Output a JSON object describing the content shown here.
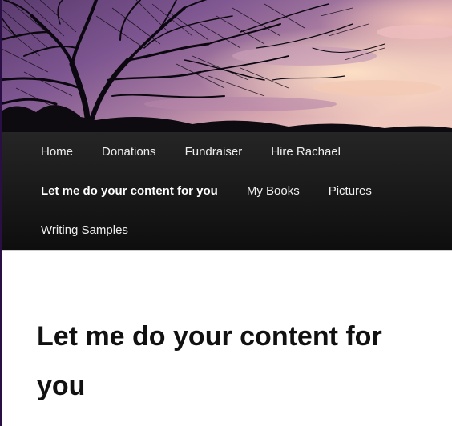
{
  "nav": {
    "items": [
      {
        "label": "Home"
      },
      {
        "label": "Donations"
      },
      {
        "label": "Fundraiser"
      },
      {
        "label": "Hire Rachael"
      },
      {
        "label": "Let me do your content for you"
      },
      {
        "label": "My Books"
      },
      {
        "label": "Pictures"
      },
      {
        "label": "Writing Samples"
      }
    ],
    "current_item": "Let me do your content for you"
  },
  "page": {
    "title": "Let me do your content for you"
  },
  "colors": {
    "nav_background": "#1a1a1a",
    "nav_text": "#eeeeee",
    "title_text": "#111111",
    "sky_purple": "#8a5a9c",
    "sky_orange": "#f2b8a0"
  }
}
